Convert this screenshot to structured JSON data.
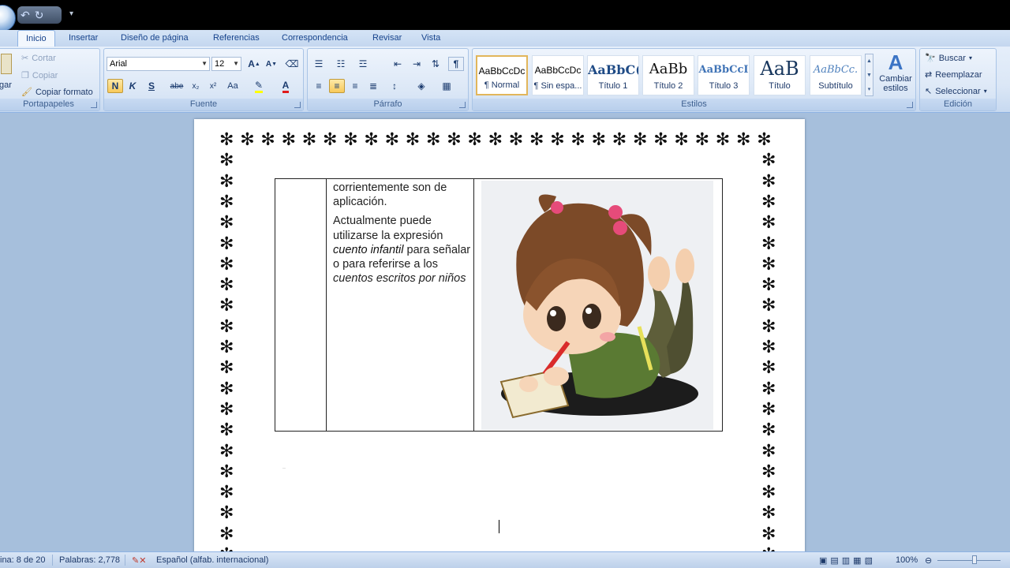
{
  "quick_access": {
    "undo_icon": "undo-icon",
    "redo_icon": "redo-icon"
  },
  "tabs": [
    "Inicio",
    "Insertar",
    "Diseño de página",
    "Referencias",
    "Correspondencia",
    "Revisar",
    "Vista"
  ],
  "clipboard": {
    "paste_label": "gar",
    "cut": "Cortar",
    "copy": "Copiar",
    "format_painter": "Copiar formato",
    "group": "Portapapeles"
  },
  "font": {
    "name": "Arial",
    "size": "12",
    "group": "Fuente",
    "bold": "N",
    "italic": "K",
    "underline": "S",
    "strike": "abe",
    "subscript": "x₂",
    "superscript": "x²",
    "case": "Aa"
  },
  "paragraph": {
    "group": "Párrafo"
  },
  "styles": {
    "group": "Estilos",
    "items": [
      {
        "preview": "AaBbCcDc",
        "name": "¶ Normal"
      },
      {
        "preview": "AaBbCcDc",
        "name": "¶ Sin espa..."
      },
      {
        "preview": "AaBbC(",
        "name": "Título 1"
      },
      {
        "preview": "AaBb",
        "name": "Título 2"
      },
      {
        "preview": "AaBbCcI",
        "name": "Título 3"
      },
      {
        "preview": "AaB",
        "name": "Título"
      },
      {
        "preview": "AaBbCc.",
        "name": "Subtítulo"
      }
    ],
    "change_styles": "Cambiar estilos"
  },
  "editing": {
    "group": "Edición",
    "find": "Buscar",
    "replace": "Reemplazar",
    "select": "Seleccionar"
  },
  "document": {
    "para1": "corrientemente son de aplicación.",
    "para2_a": "Actualmente puede utilizarse la expresión ",
    "para2_i1": "cuento infantil",
    "para2_b": " para señalar o para referirse a los ",
    "para2_i2": "cuentos escritos por niños",
    "image_desc": "girl-reading-illustration"
  },
  "status": {
    "page": "ina: 8 de 20",
    "words": "Palabras: 2,778",
    "language": "Español (alfab. internacional)",
    "zoom": "100%"
  }
}
